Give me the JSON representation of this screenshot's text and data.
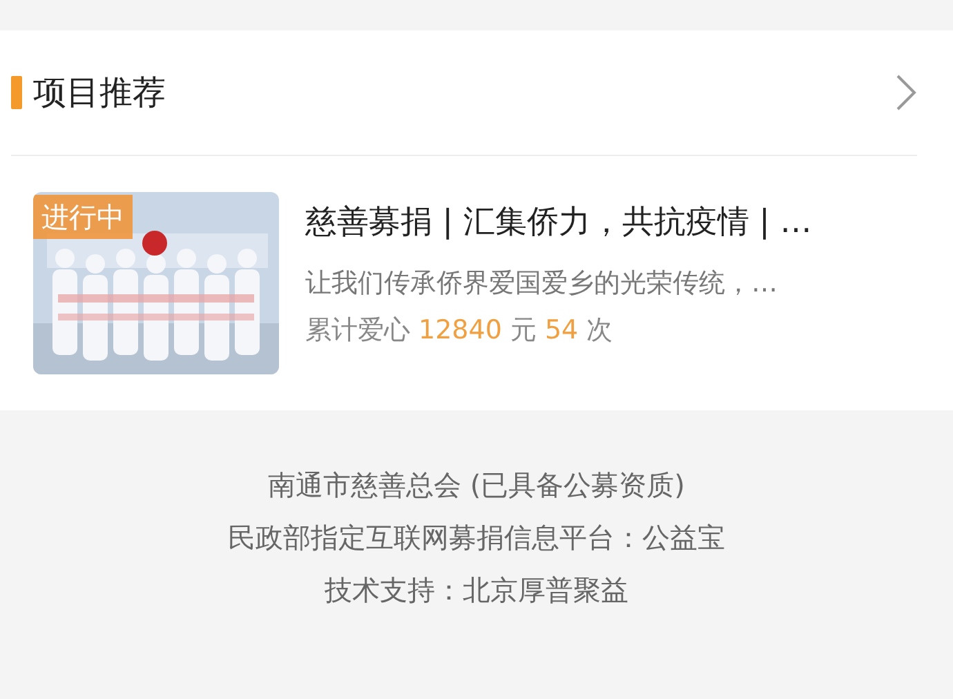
{
  "section": {
    "title": "项目推荐"
  },
  "projects": [
    {
      "badge": "进行中",
      "title": "慈善募捐 | 汇集侨力，共抗疫情 | …",
      "description": "让我们传承侨界爱国爱乡的光荣传统，…",
      "stats_label": "累计爱心",
      "amount": "12840",
      "amount_unit": "元",
      "count": "54",
      "count_unit": "次"
    }
  ],
  "footer": [
    "南通市慈善总会 (已具备公募资质)",
    "民政部指定互联网募捐信息平台：公益宝",
    "技术支持：北京厚普聚益"
  ]
}
